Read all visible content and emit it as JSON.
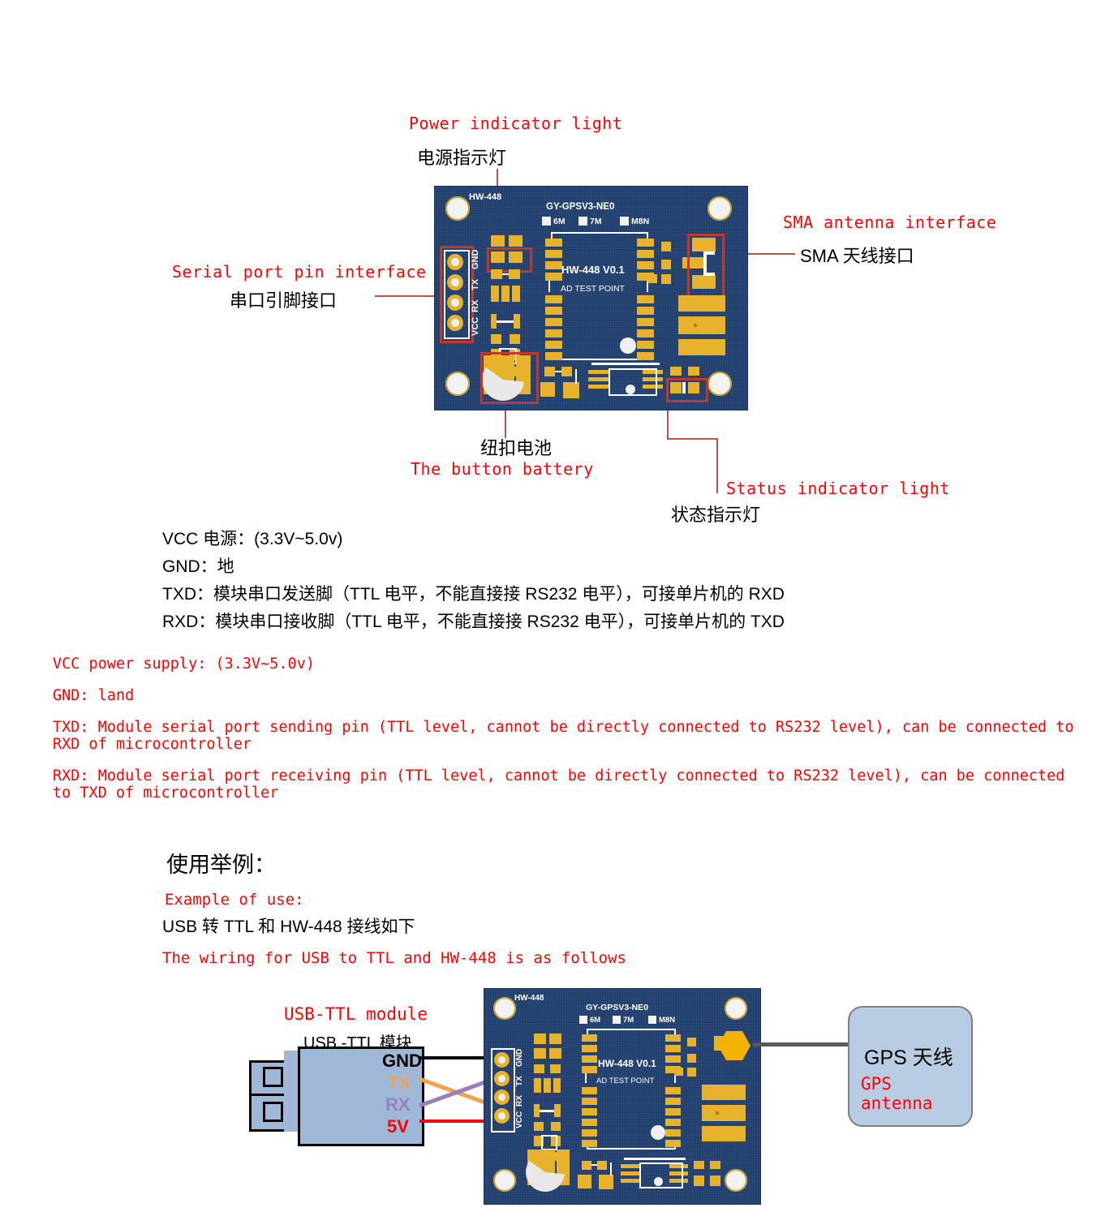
{
  "callouts": {
    "power_led": {
      "en": "Power indicator light",
      "cn": "电源指示灯"
    },
    "sma": {
      "en": "SMA antenna interface",
      "cn": "SMA 天线接口"
    },
    "serial": {
      "en": "Serial port pin interface",
      "cn": "串口引脚接口"
    },
    "battery": {
      "cn": "纽扣电池",
      "en": "The button battery"
    },
    "status_led": {
      "en": "Status indicator light",
      "cn": "状态指示灯"
    }
  },
  "pcb": {
    "mark_left": "HW-448",
    "part_number": "GY-GPSV3-NE0",
    "options": [
      "6M",
      "7M",
      "M8N"
    ],
    "version": "HW-448 V0.1",
    "test_point": "AD TEST POINT",
    "pin_labels": [
      "GND",
      "TX",
      "RX",
      "VCC"
    ]
  },
  "spec_cn": [
    "VCC 电源：(3.3V~5.0v)",
    "GND：地",
    "TXD：模块串口发送脚（TTL 电平，不能直接接 RS232 电平），可接单片机的 RXD",
    "RXD：模块串口接收脚（TTL 电平，不能直接接 RS232 电平），可接单片机的 TXD"
  ],
  "spec_en": [
    "VCC power supply: (3.3V~5.0v)",
    "GND: land",
    "TXD: Module serial port sending pin (TTL level, cannot be directly connected to RS232 level), can be connected to RXD of microcontroller",
    "RXD: Module serial port receiving pin (TTL level, cannot be directly connected to RS232 level), can be connected to TXD of microcontroller"
  ],
  "example": {
    "heading_cn": "使用举例：",
    "heading_en": "Example of use:",
    "line_cn": "USB 转 TTL 和 HW-448 接线如下",
    "line_en": "The wiring for USB to TTL and HW-448 is as follows"
  },
  "wiring": {
    "module_en": "USB-TTL module",
    "module_cn": "USB -TTL 模块",
    "pins": [
      {
        "label": "GND",
        "color": "#000000"
      },
      {
        "label": "TX",
        "color": "#f0a050"
      },
      {
        "label": "RX",
        "color": "#9a7fc0"
      },
      {
        "label": "5V",
        "color": "#ff0000"
      }
    ],
    "antenna_cn": "GPS 天线",
    "antenna_en": "GPS antenna"
  },
  "colors": {
    "pcb_blue": "#1f3e6e",
    "pad_gold": "#e8b32c",
    "highlight_red": "#c0392b",
    "accent_red": "#ff0000",
    "module_blue": "#9fb8d8",
    "antenna_blue": "#b8cce4"
  }
}
